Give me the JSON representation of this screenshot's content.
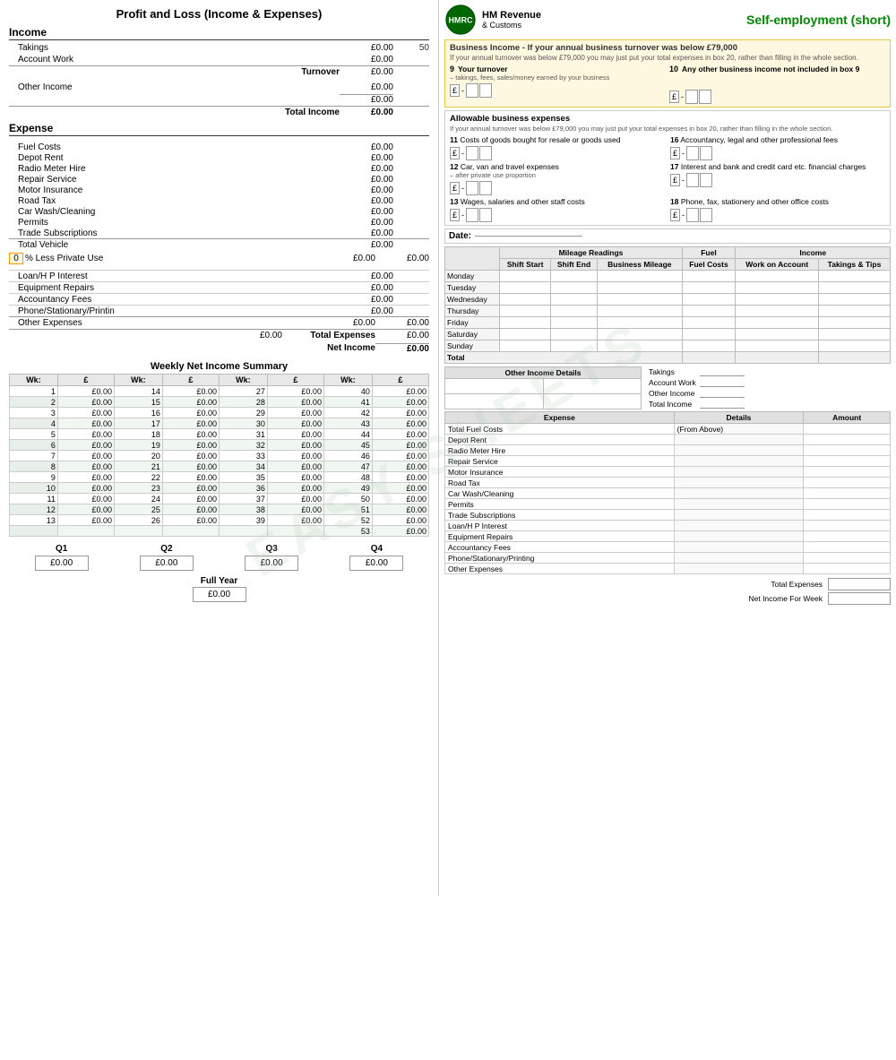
{
  "page": {
    "title": "Profit and Loss (Income & Expenses)",
    "watermark": "EASY SHEETS"
  },
  "left": {
    "title": "Profit and Loss  (Income & Expenses)",
    "income": {
      "header": "Income",
      "items": [
        {
          "label": "Takings",
          "amount": "£0.00",
          "extra": "50"
        },
        {
          "label": "Account Work",
          "amount": "£0.00",
          "extra": ""
        }
      ],
      "turnover_label": "Turnover",
      "turnover_amount": "£0.00",
      "other_income_label": "Other Income",
      "other_income_amount": "£0.00",
      "sub_amount": "£0.00",
      "total_income_label": "Total Income",
      "total_income_amount": "£0.00"
    },
    "expense": {
      "header": "Expense",
      "vehicle_items": [
        {
          "label": "Fuel Costs",
          "amount": "£0.00"
        },
        {
          "label": "Depot Rent",
          "amount": "£0.00"
        },
        {
          "label": "Radio Meter Hire",
          "amount": "£0.00"
        },
        {
          "label": "Repair Service",
          "amount": "£0.00"
        },
        {
          "label": "Motor Insurance",
          "amount": "£0.00"
        },
        {
          "label": "Road Tax",
          "amount": "£0.00"
        },
        {
          "label": "Car Wash/Cleaning",
          "amount": "£0.00"
        },
        {
          "label": "Permits",
          "amount": "£0.00"
        },
        {
          "label": "Trade Subscriptions",
          "amount": "£0.00"
        }
      ],
      "total_vehicle_label": "Total Vehicle",
      "total_vehicle_amount": "£0.00",
      "private_pct": "0",
      "private_label": "% Less Private Use",
      "private_amount1": "£0.00",
      "private_amount2": "£0.00",
      "other_items": [
        {
          "label": "Loan/H P Interest",
          "amount": "£0.00"
        },
        {
          "label": "Equipment Repairs",
          "amount": "£0.00"
        },
        {
          "label": "Accountancy Fees",
          "amount": "£0.00"
        },
        {
          "label": "Phone/Stationary/Printin",
          "amount": "£0.00"
        }
      ],
      "other_expenses_label": "Other Expenses",
      "other_expenses_amount1": "£0.00",
      "other_expenses_amount2": "£0.00",
      "total_expenses_sub": "£0.00",
      "total_expenses_label": "Total Expenses",
      "total_expenses_amount": "£0.00",
      "net_income_label": "Net Income",
      "net_income_amount": "£0.00"
    },
    "weekly": {
      "title": "Weekly Net Income Summary",
      "col_headers": [
        "Wk:",
        "£",
        "Wk:",
        "£",
        "Wk:",
        "£",
        "Wk:",
        "£"
      ],
      "rows": [
        [
          1,
          "£0.00",
          14,
          "£0.00",
          27,
          "£0.00",
          40,
          "£0.00"
        ],
        [
          2,
          "£0.00",
          15,
          "£0.00",
          28,
          "£0.00",
          41,
          "£0.00"
        ],
        [
          3,
          "£0.00",
          16,
          "£0.00",
          29,
          "£0.00",
          42,
          "£0.00"
        ],
        [
          4,
          "£0.00",
          17,
          "£0.00",
          30,
          "£0.00",
          43,
          "£0.00"
        ],
        [
          5,
          "£0.00",
          18,
          "£0.00",
          31,
          "£0.00",
          44,
          "£0.00"
        ],
        [
          6,
          "£0.00",
          19,
          "£0.00",
          32,
          "£0.00",
          45,
          "£0.00"
        ],
        [
          7,
          "£0.00",
          20,
          "£0.00",
          33,
          "£0.00",
          46,
          "£0.00"
        ],
        [
          8,
          "£0.00",
          21,
          "£0.00",
          34,
          "£0.00",
          47,
          "£0.00"
        ],
        [
          9,
          "£0.00",
          22,
          "£0.00",
          35,
          "£0.00",
          48,
          "£0.00"
        ],
        [
          10,
          "£0.00",
          23,
          "£0.00",
          36,
          "£0.00",
          49,
          "£0.00"
        ],
        [
          11,
          "£0.00",
          24,
          "£0.00",
          37,
          "£0.00",
          50,
          "£0.00"
        ],
        [
          12,
          "£0.00",
          25,
          "£0.00",
          38,
          "£0.00",
          51,
          "£0.00"
        ],
        [
          13,
          "£0.00",
          26,
          "£0.00",
          39,
          "£0.00",
          52,
          "£0.00"
        ],
        [
          "",
          "",
          "",
          "",
          "",
          "",
          53,
          "£0.00"
        ]
      ]
    },
    "quarterly": {
      "items": [
        {
          "label": "Q1",
          "amount": "£0.00"
        },
        {
          "label": "Q2",
          "amount": "£0.00"
        },
        {
          "label": "Q3",
          "amount": "£0.00"
        },
        {
          "label": "Q4",
          "amount": "£0.00"
        }
      ],
      "full_year_label": "Full Year",
      "full_year_amount": "£0.00"
    }
  },
  "right": {
    "hmrc": {
      "logo_text": "HM Revenue",
      "logo_sub": "& Customs",
      "title": "Self-employment (short)"
    },
    "business_income": {
      "title": "Business Income - If your annual business turnover was below £79,000",
      "note": "If your annual turnover was below £79,000 you may just put your total expenses in box 20, rather than filling in the whole section.",
      "box9_label": "9",
      "box9_title": "Your turnover",
      "box9_sublabel": "– takings, fees, sales/money earned by your business",
      "box10_label": "10",
      "box10_title": "Any other business income not included in box 9"
    },
    "allowable": {
      "title": "Allowable business expenses",
      "note": "If your annual turnover was below £79,000 you may just put your total expenses in box 20, rather than filling in the whole section.",
      "items": [
        {
          "num": "11",
          "label": "Costs of goods bought for resale or goods used",
          "col": 0
        },
        {
          "num": "16",
          "label": "Accountancy, legal and other professional fees",
          "col": 1
        },
        {
          "num": "12",
          "label": "Car, van and travel expenses",
          "col": 0
        },
        {
          "num": "12_sub",
          "label": "– after private use proportion",
          "col": 0
        },
        {
          "num": "17",
          "label": "Interest and bank and credit card etc. financial charges",
          "col": 1
        },
        {
          "num": "13",
          "label": "Wages, salaries and other staff costs",
          "col": 0
        },
        {
          "num": "18",
          "label": "Phone, fax, stationery and other office costs",
          "col": 1
        }
      ]
    },
    "date_label": "Date:",
    "mileage": {
      "headers": [
        "",
        "Shift Start",
        "Shift End",
        "Business Mileage",
        "Fuel Costs",
        "Work on Account",
        "Takings & Tips"
      ],
      "group_headers": [
        "Mileage Readings",
        "Fuel",
        "Income"
      ],
      "days": [
        "Monday",
        "Tuesday",
        "Wednesday",
        "Thursday",
        "Friday",
        "Saturday",
        "Sunday"
      ],
      "total_label": "Total"
    },
    "other_income": {
      "title": "Other Income Details",
      "rows": [
        "",
        ""
      ]
    },
    "right_totals": {
      "takings": "Takings",
      "account_work": "Account Work",
      "other_income": "Other Income",
      "total_income": "Total Income"
    },
    "expense_table": {
      "headers": [
        "Expense",
        "Details",
        "Amount"
      ],
      "detail_label": "(From Above)",
      "items": [
        "Total Fuel Costs",
        "Depot Rent",
        "Radio Meter Hire",
        "Repair Service",
        "Motor Insurance",
        "Road Tax",
        "Car Wash/Cleaning",
        "Permits",
        "Trade Subscriptions",
        "Loan/H P Interest",
        "Equipment Repairs",
        "Accountancy Fees",
        "Phone/Stationary/Printing",
        "Other Expenses"
      ]
    },
    "bottom": {
      "total_expenses_label": "Total Expenses",
      "net_income_label": "Net Income For Week"
    }
  }
}
